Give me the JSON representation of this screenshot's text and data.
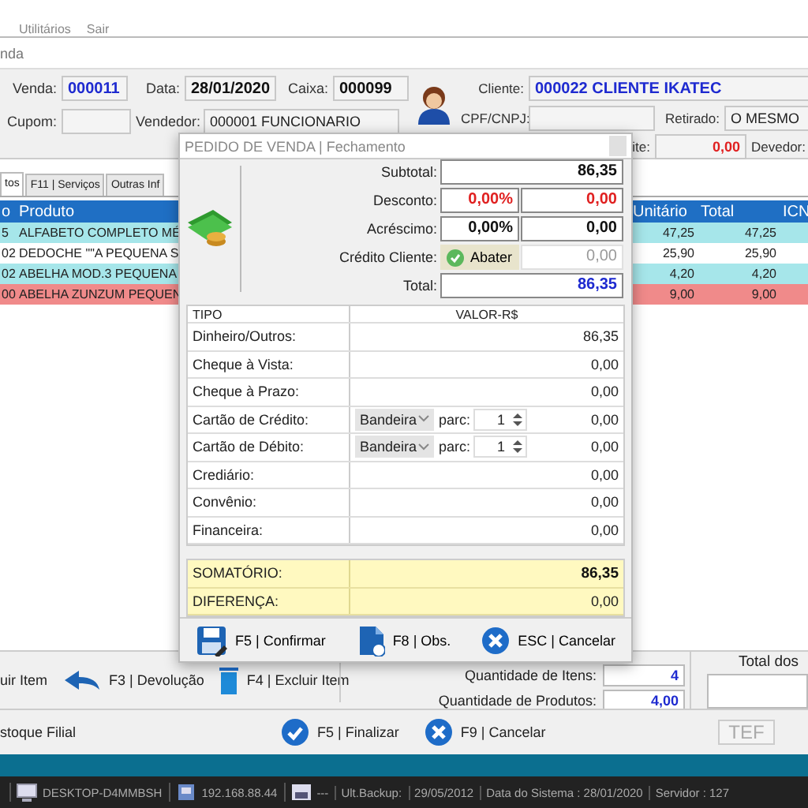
{
  "menu": [
    "Utilitários",
    "Sair"
  ],
  "window": {
    "title": "nda"
  },
  "header": {
    "left": [
      [
        {
          "label": "Venda:",
          "value": "000011"
        },
        {
          "label": "Data:",
          "value": "28/01/2020"
        },
        {
          "label": "Caixa:",
          "value": "000099"
        }
      ],
      [
        {
          "label": "Cupom:"
        },
        {
          "label": "Vendedor:",
          "value": "000001  FUNCIONARIO"
        }
      ]
    ],
    "right": [
      [
        {
          "label": "Cliente:",
          "value": "000022  CLIENTE IKATEC"
        }
      ],
      [
        {
          "label": "CPF/CNPJ:"
        },
        {
          "label": "Retirado:",
          "value": "O MESMO"
        }
      ],
      [
        {
          "label": "ite:",
          "value": "0,00"
        },
        {
          "label": "Devedor:"
        }
      ]
    ]
  },
  "tabs": [
    {
      "label": "tos",
      "selected": true
    },
    {
      "label": "F11 | Serviços",
      "selected": false
    },
    {
      "label": "Outras Inf",
      "selected": false
    }
  ],
  "table": {
    "columns": [
      "o",
      "Produto",
      "Unitário",
      "Total",
      "ICN"
    ],
    "rows": [
      {
        "cells": [
          "5",
          "ALFABETO COMPLETO MÉ",
          "47,25",
          "47,25"
        ],
        "color": "#a6e6ea"
      },
      {
        "cells": [
          "02",
          "DEDOCHE \"\"A PEQUENA S",
          "25,90",
          "25,90"
        ],
        "color": "#ffffff"
      },
      {
        "cells": [
          "02",
          "ABELHA MOD.3 PEQUENA",
          "4,20",
          "4,20"
        ],
        "color": "#a6e6ea"
      },
      {
        "cells": [
          "00",
          "ABELHA ZUNZUM PEQUEN",
          "9,00",
          "9,00"
        ],
        "color": "#f08a8a"
      }
    ]
  },
  "dialog": {
    "title": "PEDIDO DE VENDA | Fechamento",
    "summary": [
      {
        "kind": "single",
        "label": "Subtotal:",
        "value": "86,35"
      },
      {
        "kind": "pair",
        "label": "Desconto:",
        "percent": "0,00%",
        "value": "0,00"
      },
      {
        "kind": "pair",
        "label": "Acréscimo:",
        "percent": "0,00%",
        "value": "0,00"
      },
      {
        "kind": "credit",
        "label": "Crédito Cliente:",
        "button": "Abater",
        "value": "0,00",
        "disabled": true
      },
      {
        "kind": "single",
        "label": "Total:",
        "value": "86,35"
      }
    ],
    "payments": {
      "columns": [
        "TIPO",
        "VALOR-R$"
      ],
      "rows": [
        {
          "kind": "plain",
          "label": "Dinheiro/Outros:",
          "value": "86,35"
        },
        {
          "kind": "plain",
          "label": "Cheque à Vista:",
          "value": "0,00"
        },
        {
          "kind": "plain",
          "label": "Cheque à Prazo:",
          "value": "0,00"
        },
        {
          "kind": "card",
          "label": "Cartão de Crédito:",
          "brand": "Bandeira",
          "parc_label": "parc:",
          "parc": "1",
          "value": "0,00"
        },
        {
          "kind": "card",
          "label": "Cartão de Débito:",
          "brand": "Bandeira",
          "parc_label": "parc:",
          "parc": "1",
          "value": "0,00"
        },
        {
          "kind": "plain",
          "label": "Crediário:",
          "value": "0,00"
        },
        {
          "kind": "plain",
          "label": "Convênio:",
          "value": "0,00"
        },
        {
          "kind": "plain",
          "label": "Financeira:",
          "value": "0,00"
        }
      ],
      "totals": [
        {
          "label": "SOMATÓRIO:",
          "value": "86,35"
        },
        {
          "label": "DIFERENÇA:",
          "value": "0,00"
        }
      ]
    },
    "buttons": [
      "F5 | Confirmar",
      "F8 | Obs.",
      "ESC | Cancelar"
    ]
  },
  "actions": [
    "uir Item",
    "F3 | Devolução",
    "F4 | Excluir Item"
  ],
  "quantities": [
    {
      "label": "Quantidade de Itens:",
      "value": "4"
    },
    {
      "label": "Quantidade de Produtos:",
      "value": "4,00"
    }
  ],
  "total_label": "Total dos",
  "footer": {
    "left": "stoque Filial",
    "buttons": [
      "F5 | Finalizar",
      "F9 | Cancelar"
    ],
    "tef": {
      "label": "TEF",
      "disabled": true
    }
  },
  "status_bar": [
    "DESKTOP-D4MMBSH",
    "192.168.88.44",
    "---",
    "Ult.Backup:",
    "29/05/2012",
    "Data do Sistema : 28/01/2020",
    "Servidor : 127"
  ]
}
